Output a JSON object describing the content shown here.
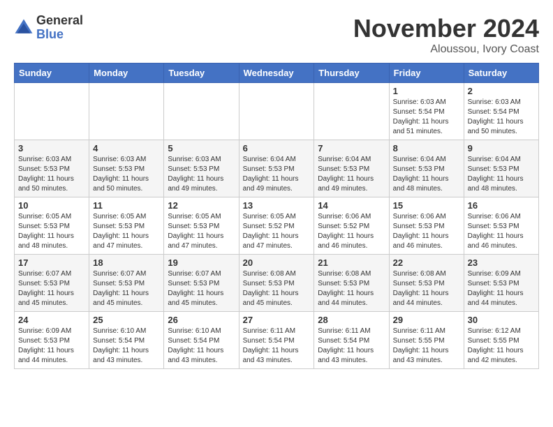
{
  "logo": {
    "general": "General",
    "blue": "Blue"
  },
  "header": {
    "month": "November 2024",
    "location": "Aloussou, Ivory Coast"
  },
  "weekdays": [
    "Sunday",
    "Monday",
    "Tuesday",
    "Wednesday",
    "Thursday",
    "Friday",
    "Saturday"
  ],
  "weeks": [
    [
      {
        "day": null,
        "info": null
      },
      {
        "day": null,
        "info": null
      },
      {
        "day": null,
        "info": null
      },
      {
        "day": null,
        "info": null
      },
      {
        "day": null,
        "info": null
      },
      {
        "day": "1",
        "info": "Sunrise: 6:03 AM\nSunset: 5:54 PM\nDaylight: 11 hours\nand 51 minutes."
      },
      {
        "day": "2",
        "info": "Sunrise: 6:03 AM\nSunset: 5:54 PM\nDaylight: 11 hours\nand 50 minutes."
      }
    ],
    [
      {
        "day": "3",
        "info": "Sunrise: 6:03 AM\nSunset: 5:53 PM\nDaylight: 11 hours\nand 50 minutes."
      },
      {
        "day": "4",
        "info": "Sunrise: 6:03 AM\nSunset: 5:53 PM\nDaylight: 11 hours\nand 50 minutes."
      },
      {
        "day": "5",
        "info": "Sunrise: 6:03 AM\nSunset: 5:53 PM\nDaylight: 11 hours\nand 49 minutes."
      },
      {
        "day": "6",
        "info": "Sunrise: 6:04 AM\nSunset: 5:53 PM\nDaylight: 11 hours\nand 49 minutes."
      },
      {
        "day": "7",
        "info": "Sunrise: 6:04 AM\nSunset: 5:53 PM\nDaylight: 11 hours\nand 49 minutes."
      },
      {
        "day": "8",
        "info": "Sunrise: 6:04 AM\nSunset: 5:53 PM\nDaylight: 11 hours\nand 48 minutes."
      },
      {
        "day": "9",
        "info": "Sunrise: 6:04 AM\nSunset: 5:53 PM\nDaylight: 11 hours\nand 48 minutes."
      }
    ],
    [
      {
        "day": "10",
        "info": "Sunrise: 6:05 AM\nSunset: 5:53 PM\nDaylight: 11 hours\nand 48 minutes."
      },
      {
        "day": "11",
        "info": "Sunrise: 6:05 AM\nSunset: 5:53 PM\nDaylight: 11 hours\nand 47 minutes."
      },
      {
        "day": "12",
        "info": "Sunrise: 6:05 AM\nSunset: 5:53 PM\nDaylight: 11 hours\nand 47 minutes."
      },
      {
        "day": "13",
        "info": "Sunrise: 6:05 AM\nSunset: 5:52 PM\nDaylight: 11 hours\nand 47 minutes."
      },
      {
        "day": "14",
        "info": "Sunrise: 6:06 AM\nSunset: 5:52 PM\nDaylight: 11 hours\nand 46 minutes."
      },
      {
        "day": "15",
        "info": "Sunrise: 6:06 AM\nSunset: 5:53 PM\nDaylight: 11 hours\nand 46 minutes."
      },
      {
        "day": "16",
        "info": "Sunrise: 6:06 AM\nSunset: 5:53 PM\nDaylight: 11 hours\nand 46 minutes."
      }
    ],
    [
      {
        "day": "17",
        "info": "Sunrise: 6:07 AM\nSunset: 5:53 PM\nDaylight: 11 hours\nand 45 minutes."
      },
      {
        "day": "18",
        "info": "Sunrise: 6:07 AM\nSunset: 5:53 PM\nDaylight: 11 hours\nand 45 minutes."
      },
      {
        "day": "19",
        "info": "Sunrise: 6:07 AM\nSunset: 5:53 PM\nDaylight: 11 hours\nand 45 minutes."
      },
      {
        "day": "20",
        "info": "Sunrise: 6:08 AM\nSunset: 5:53 PM\nDaylight: 11 hours\nand 45 minutes."
      },
      {
        "day": "21",
        "info": "Sunrise: 6:08 AM\nSunset: 5:53 PM\nDaylight: 11 hours\nand 44 minutes."
      },
      {
        "day": "22",
        "info": "Sunrise: 6:08 AM\nSunset: 5:53 PM\nDaylight: 11 hours\nand 44 minutes."
      },
      {
        "day": "23",
        "info": "Sunrise: 6:09 AM\nSunset: 5:53 PM\nDaylight: 11 hours\nand 44 minutes."
      }
    ],
    [
      {
        "day": "24",
        "info": "Sunrise: 6:09 AM\nSunset: 5:53 PM\nDaylight: 11 hours\nand 44 minutes."
      },
      {
        "day": "25",
        "info": "Sunrise: 6:10 AM\nSunset: 5:54 PM\nDaylight: 11 hours\nand 43 minutes."
      },
      {
        "day": "26",
        "info": "Sunrise: 6:10 AM\nSunset: 5:54 PM\nDaylight: 11 hours\nand 43 minutes."
      },
      {
        "day": "27",
        "info": "Sunrise: 6:11 AM\nSunset: 5:54 PM\nDaylight: 11 hours\nand 43 minutes."
      },
      {
        "day": "28",
        "info": "Sunrise: 6:11 AM\nSunset: 5:54 PM\nDaylight: 11 hours\nand 43 minutes."
      },
      {
        "day": "29",
        "info": "Sunrise: 6:11 AM\nSunset: 5:55 PM\nDaylight: 11 hours\nand 43 minutes."
      },
      {
        "day": "30",
        "info": "Sunrise: 6:12 AM\nSunset: 5:55 PM\nDaylight: 11 hours\nand 42 minutes."
      }
    ]
  ]
}
